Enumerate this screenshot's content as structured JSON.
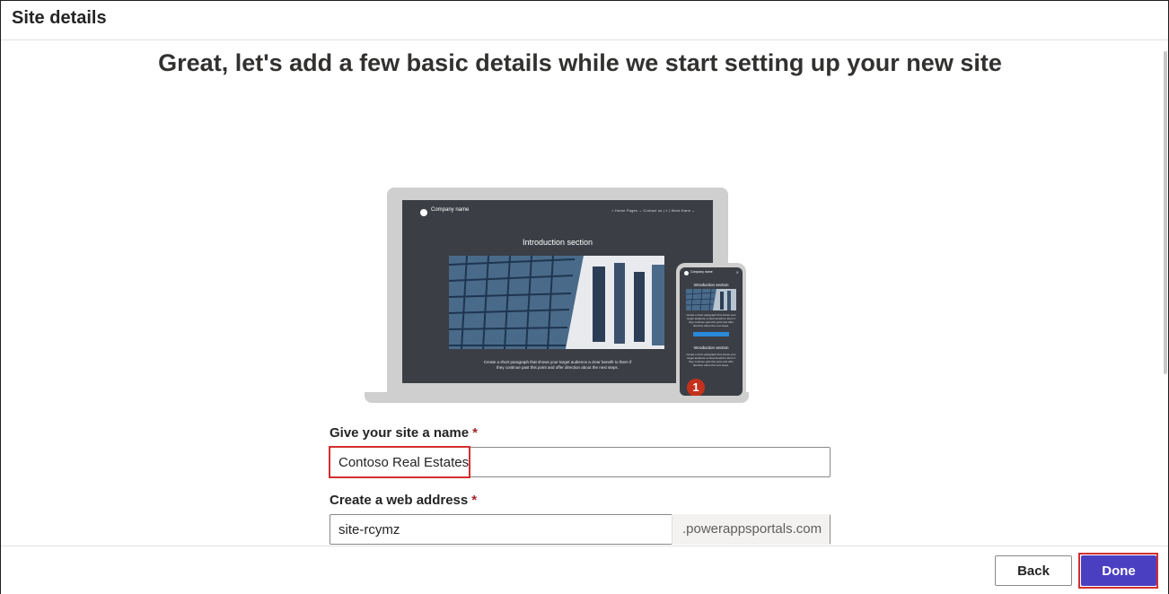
{
  "header": {
    "title": "Site details"
  },
  "main": {
    "headline": "Great, let's add a few basic details while we start setting up your new site"
  },
  "illustration": {
    "laptop": {
      "company_name": "Company name",
      "nav_text": "⌂ Home   Pages ⌄   Contact us   |   ⌕   |   Work Kane ⌄",
      "intro_title": "Introduction section",
      "caption": "Create a short paragraph that shows your target audience a clear benefit to them if they continue past this point and offer direction about the next steps."
    },
    "phone": {
      "company_name": "Company name",
      "close_glyph": "✕",
      "intro_title_1": "Introduction section",
      "text_1": "Create a short paragraph that shows your target audience a clear benefit to them if they continue past this point and offer direction about the next steps.",
      "intro_title_2": "Introduction section",
      "text_2": "Create a short paragraph that shows your target audience a clear benefit to them if they continue past this point and offer direction about the next steps.",
      "badge_number": "1"
    }
  },
  "form": {
    "site_name": {
      "label": "Give your site a name",
      "required_marker": "*",
      "value": "Contoso Real Estates"
    },
    "web_address": {
      "label": "Create a web address",
      "required_marker": "*",
      "value": "site-rcymz",
      "suffix": ".powerappsportals.com"
    }
  },
  "footer": {
    "back_label": "Back",
    "done_label": "Done"
  },
  "colors": {
    "primary": "#4b3fc1",
    "highlight": "#d32f2f",
    "required": "#a4262c",
    "badge": "#c4311c"
  }
}
